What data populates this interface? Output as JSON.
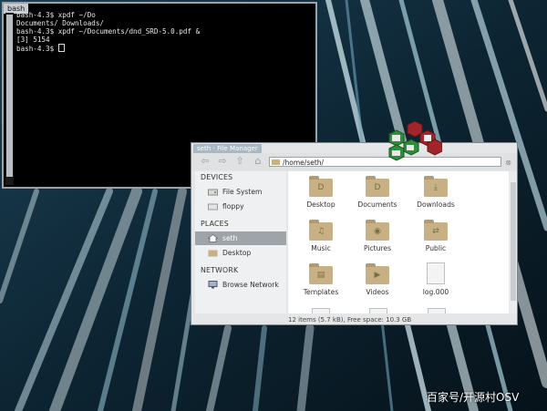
{
  "terminal": {
    "title": "bash",
    "lines": [
      "bash-4.3$ xpdf ~/Do",
      "Documents/ Downloads/",
      "bash-4.3$ xpdf ~/Documents/dnd_SRD-5.0.pdf &",
      "[3] 5154",
      "bash-4.3$ "
    ]
  },
  "file_manager": {
    "title": "seth - File Manager",
    "address": "/home/seth/",
    "sidebar": {
      "devices_heading": "DEVICES",
      "devices": [
        "File System",
        "floppy"
      ],
      "places_heading": "PLACES",
      "places": [
        "seth",
        "Desktop"
      ],
      "network_heading": "NETWORK",
      "network": [
        "Browse Network"
      ]
    },
    "items": [
      {
        "label": "Desktop",
        "glyph": "D",
        "kind": "folder"
      },
      {
        "label": "Documents",
        "glyph": "D",
        "kind": "folder"
      },
      {
        "label": "Downloads",
        "glyph": "⤓",
        "kind": "folder"
      },
      {
        "label": "Music",
        "glyph": "♫",
        "kind": "folder"
      },
      {
        "label": "Pictures",
        "glyph": "◉",
        "kind": "folder"
      },
      {
        "label": "Public",
        "glyph": "⇄",
        "kind": "folder"
      },
      {
        "label": "Templates",
        "glyph": "▤",
        "kind": "folder"
      },
      {
        "label": "Videos",
        "glyph": "▶",
        "kind": "folder"
      },
      {
        "label": "log.000",
        "glyph": "",
        "kind": "document"
      }
    ],
    "status": "12 items (5.7 kB), Free space: 10.3 GB"
  },
  "watermark": "百家号/开源村OSV",
  "colors": {
    "desktop_bg": "#0b1a24",
    "folder": "#c6b084",
    "selection": "#9ea4aa",
    "hex_red": "#a3252c",
    "hex_green": "#2e8f3a"
  }
}
